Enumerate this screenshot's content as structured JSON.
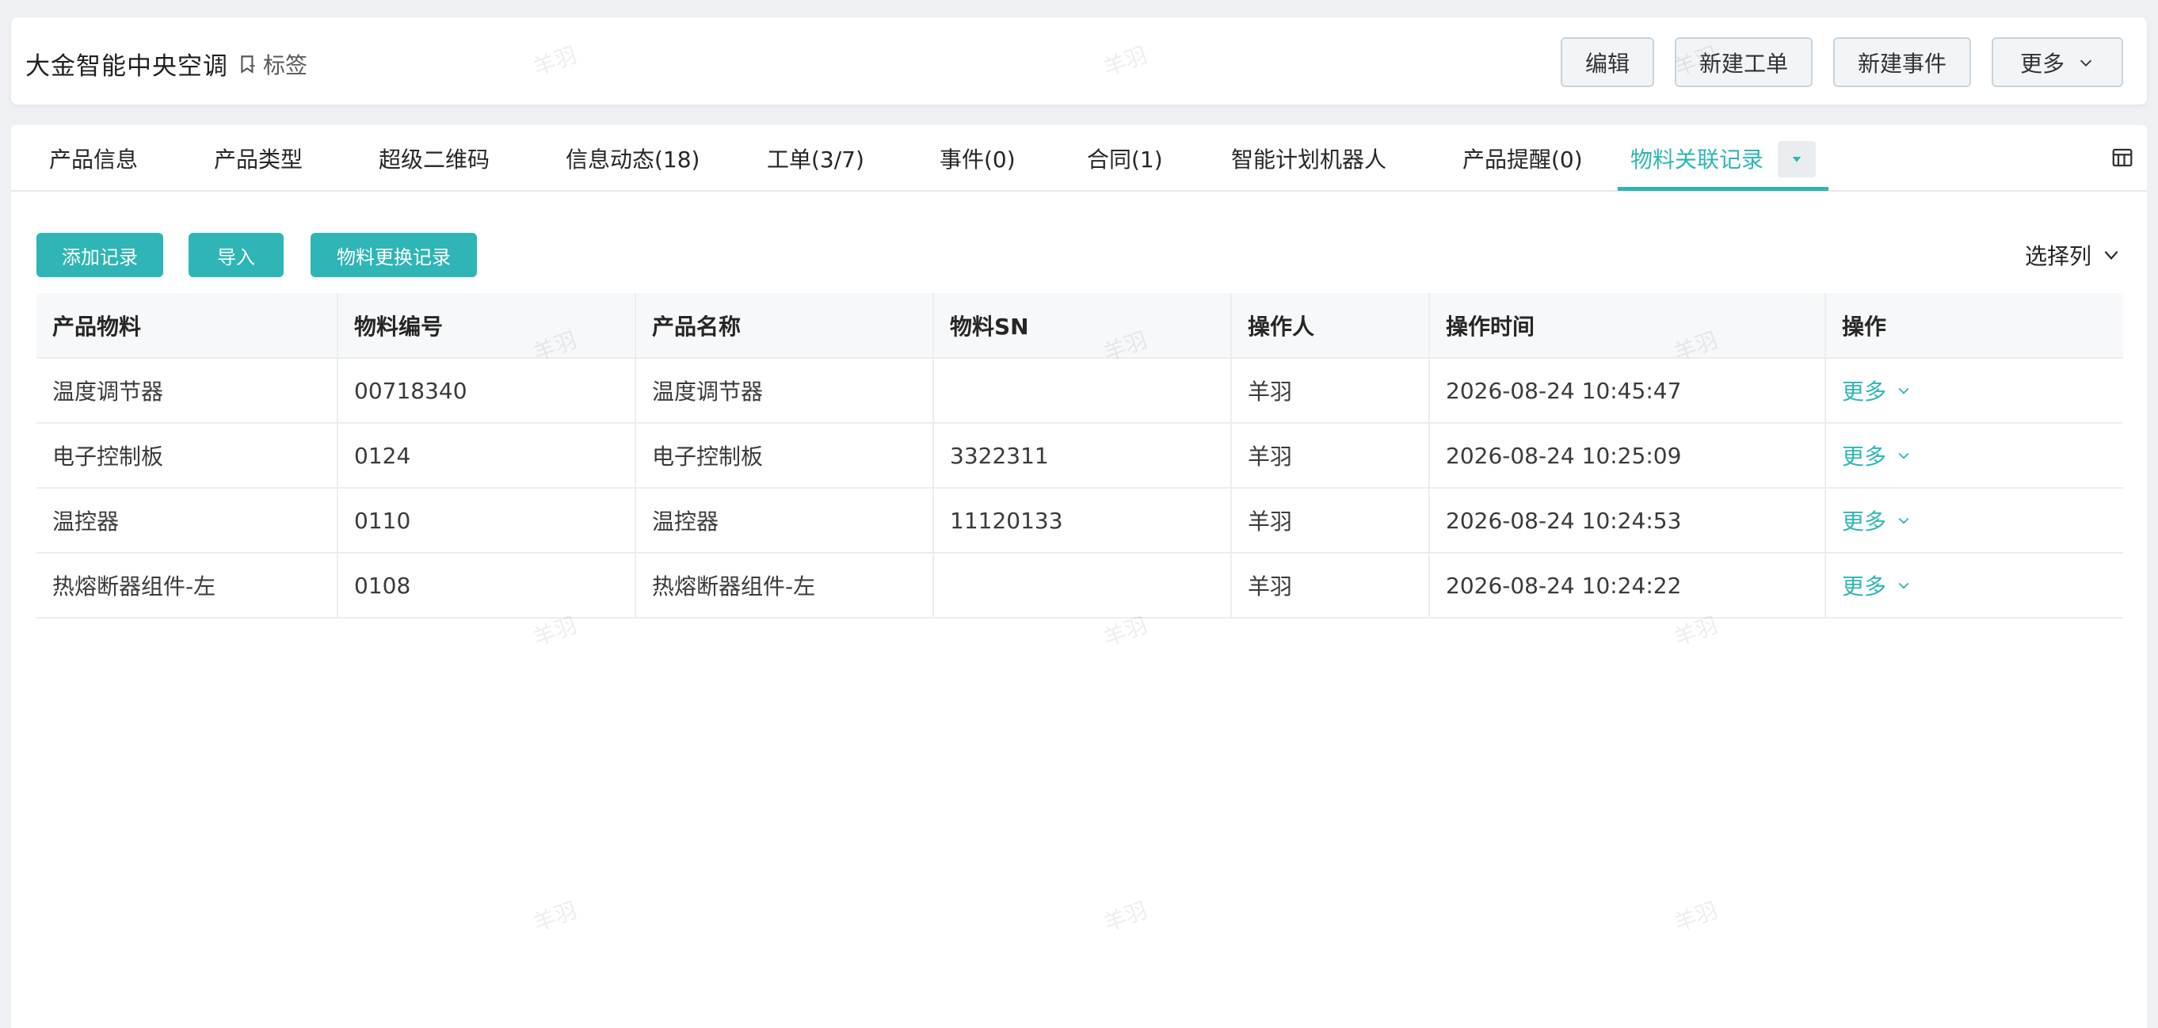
{
  "header": {
    "title": "大金智能中央空调",
    "tag_label": "标签",
    "buttons": {
      "edit": "编辑",
      "new_work_order": "新建工单",
      "new_event": "新建事件",
      "more": "更多"
    }
  },
  "tabs": [
    {
      "label": "产品信息"
    },
    {
      "label": "产品类型"
    },
    {
      "label": "超级二维码"
    },
    {
      "label": "信息动态(18)"
    },
    {
      "label": "工单(3/7)"
    },
    {
      "label": "事件(0)"
    },
    {
      "label": "合同(1)"
    },
    {
      "label": "智能计划机器人"
    },
    {
      "label": "产品提醒(0)"
    },
    {
      "label": "物料关联记录",
      "active": true
    }
  ],
  "toolbar": {
    "add_record": "添加记录",
    "import": "导入",
    "replace_record": "物料更换记录",
    "select_columns": "选择列"
  },
  "table": {
    "columns": [
      "产品物料",
      "物料编号",
      "产品名称",
      "物料SN",
      "操作人",
      "操作时间",
      "操作"
    ],
    "rows": [
      {
        "material": "温度调节器",
        "code": "00718340",
        "product": "温度调节器",
        "sn": "",
        "operator": "羊羽",
        "time": "2026-08-24 10:45:47",
        "action": "更多"
      },
      {
        "material": "电子控制板",
        "code": "0124",
        "product": "电子控制板",
        "sn": "3322311",
        "operator": "羊羽",
        "time": "2026-08-24 10:25:09",
        "action": "更多"
      },
      {
        "material": "温控器",
        "code": "0110",
        "product": "温控器",
        "sn": "11120133",
        "operator": "羊羽",
        "time": "2026-08-24 10:24:53",
        "action": "更多"
      },
      {
        "material": "热熔断器组件-左",
        "code": "0108",
        "product": "热熔断器组件-左",
        "sn": "",
        "operator": "羊羽",
        "time": "2026-08-24 10:24:22",
        "action": "更多"
      }
    ]
  },
  "watermark": "羊羽",
  "colors": {
    "accent": "#2fb5b5",
    "background": "#eef0f4"
  }
}
